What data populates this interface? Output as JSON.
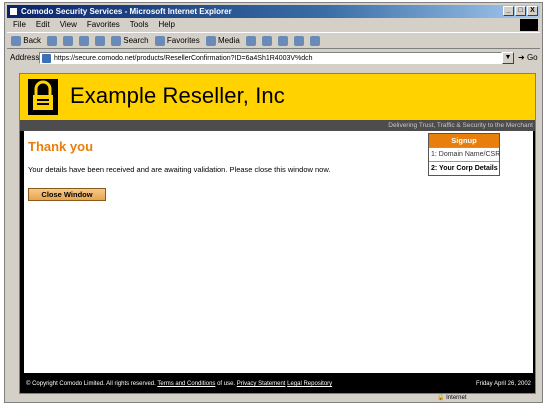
{
  "window": {
    "title": "Comodo Security Services - Microsoft Internet Explorer",
    "controls": [
      "_",
      "□",
      "X"
    ]
  },
  "menu": [
    "File",
    "Edit",
    "View",
    "Favorites",
    "Tools",
    "Help"
  ],
  "toolbar": {
    "back": "Back",
    "search": "Search",
    "favorites": "Favorites",
    "media": "Media"
  },
  "address": {
    "label": "Address",
    "url": "https://secure.comodo.net/products/ResellerConfirmation?ID=6a4Sh1R4003V%dch",
    "go": "Go"
  },
  "site": {
    "title": "Example Reseller, Inc",
    "tagline": "Delivering Trust, Traffic & Security to the Merchant"
  },
  "content": {
    "heading": "Thank you",
    "message": "Your details have been received and are awaiting validation. Please close this window now.",
    "close_button": "Close Window"
  },
  "steps": {
    "header": "Signup",
    "items": [
      "1: Domain Name/CSR",
      "2: Your Corp Details"
    ],
    "active_index": 1
  },
  "footer": {
    "copyright": "© Copyright Comodo Limited. All rights reserved. ",
    "terms_link": "Terms and Conditions",
    "of_use": " of use. ",
    "privacy_link": "Privacy Statement",
    "legal_link": "Legal Repository",
    "date": "Friday April 26, 2002"
  },
  "status": {
    "zone": "Internet"
  },
  "colors": {
    "header_yellow": "#ffd200",
    "accent_orange": "#e87e0b"
  }
}
